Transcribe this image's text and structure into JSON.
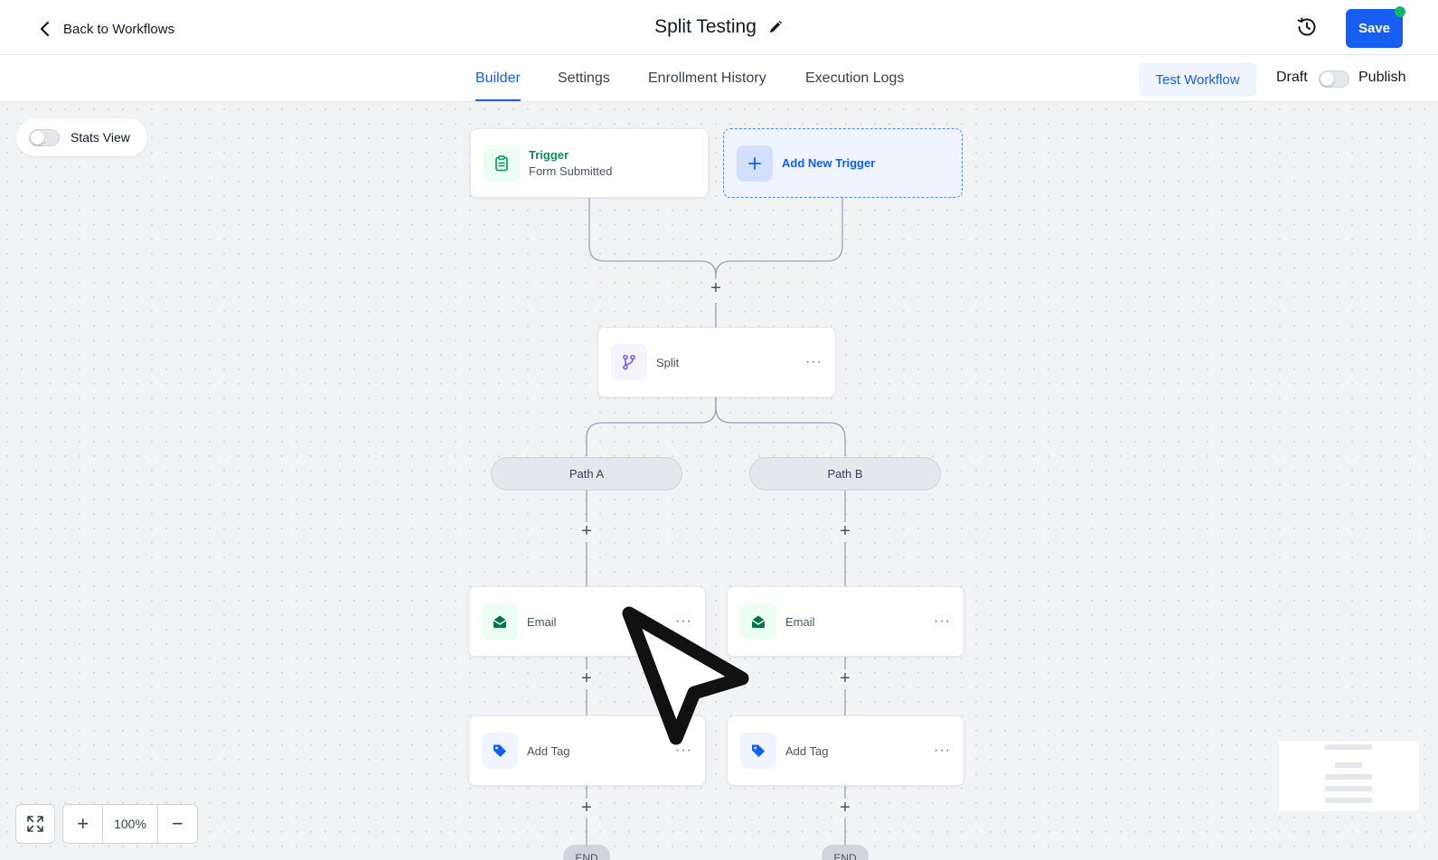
{
  "header": {
    "back_label": "Back to Workflows",
    "title": "Split Testing",
    "save_label": "Save"
  },
  "tabs": [
    {
      "label": "Builder",
      "active": true
    },
    {
      "label": "Settings",
      "active": false
    },
    {
      "label": "Enrollment History",
      "active": false
    },
    {
      "label": "Execution Logs",
      "active": false
    }
  ],
  "actions": {
    "test_label": "Test Workflow",
    "draft_label": "Draft",
    "publish_label": "Publish",
    "published": false
  },
  "canvas": {
    "stats_view_label": "Stats View",
    "stats_view_on": false,
    "trigger": {
      "title": "Trigger",
      "subtitle": "Form Submitted"
    },
    "add_trigger_label": "Add New Trigger",
    "split_label": "Split",
    "paths": [
      {
        "label": "Path A",
        "steps": [
          "Email",
          "Add Tag"
        ],
        "end_label": "END"
      },
      {
        "label": "Path B",
        "steps": [
          "Email",
          "Add Tag"
        ],
        "end_label": "END"
      }
    ],
    "more_glyph": "···",
    "plus_glyph": "+"
  },
  "zoom": {
    "in_glyph": "+",
    "level": "100%",
    "out_glyph": "−"
  },
  "colors": {
    "accent": "#155eef",
    "trigger_green": "#079455",
    "email_green": "#067647",
    "tag_blue": "#155eef",
    "split_purple": "#7a5af8",
    "status_dot": "#12b76a"
  },
  "icons": {
    "back": "chevron-left-icon",
    "edit": "pencil-icon",
    "history": "history-clock-icon",
    "trigger": "clipboard-icon",
    "add": "plus-icon",
    "split": "git-branch-icon",
    "email": "envelope-open-icon",
    "tag": "tag-icon",
    "fit": "expand-icon"
  }
}
